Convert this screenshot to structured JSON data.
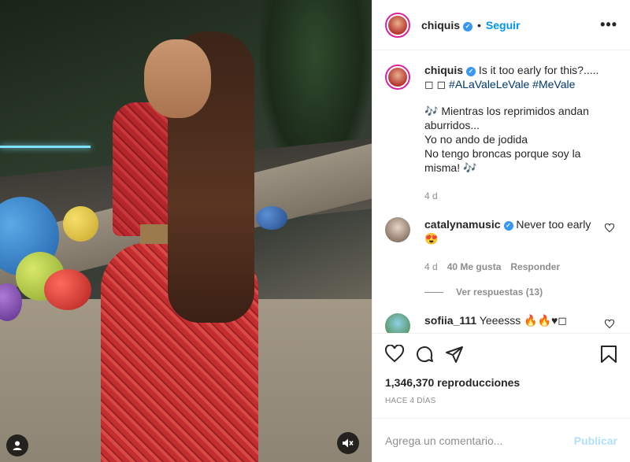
{
  "post": {
    "username": "chiquis",
    "follow_label": "Seguir",
    "separator": "•",
    "more_label": "•••"
  },
  "caption": {
    "username": "chiquis",
    "text": "Is it too early for this?.....",
    "box1": "◻",
    "box2": "◻",
    "tag1": "#ALaValeLeVale",
    "tag2": "#MeVale",
    "body": "🎶 Mientras los reprimidos andan aburridos...\nYo no ando de jodida\nNo tengo broncas porque soy la misma! 🎶",
    "age": "4 d"
  },
  "comments": [
    {
      "username": "catalynamusic",
      "text": "Never too early😍",
      "age": "4 d",
      "likes": "40 Me gusta",
      "reply_label": "Responder"
    },
    {
      "username": "sofiia_111",
      "text": "Yeeesss 🔥🔥♥◻"
    }
  ],
  "replies_label": "Ver respuestas (13)",
  "views": "1,346,370 reproducciones",
  "timestamp": "HACE 4 DÍAS",
  "comment_input": {
    "placeholder": "Agrega un comentario..."
  },
  "publish_label": "Publicar",
  "icons": {
    "heart": "heart-icon",
    "comment": "comment-icon",
    "share": "share-icon",
    "save": "bookmark-icon",
    "user": "user-tag-icon",
    "mute": "mute-icon"
  },
  "colors": {
    "accent": "#0095f6",
    "verified": "#3897f0",
    "publish_disabled": "#b2dffc",
    "muted_text": "#8e8e8e"
  }
}
